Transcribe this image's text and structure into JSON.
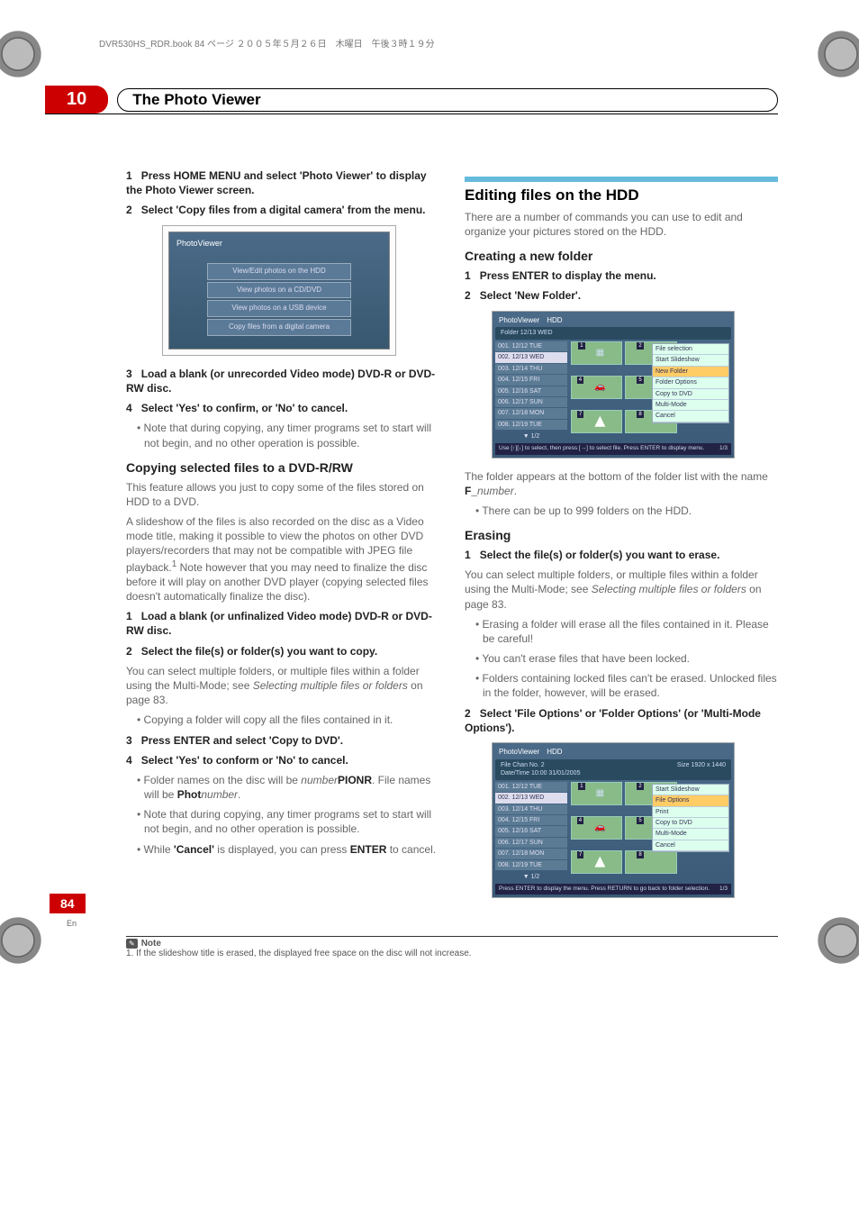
{
  "header_line": "DVR530HS_RDR.book  84 ページ  ２００５年５月２６日　木曜日　午後３時１９分",
  "chapter": {
    "num": "10",
    "title": "The Photo Viewer"
  },
  "left": {
    "s1": "Press HOME MENU and select 'Photo Viewer' to display the Photo Viewer screen.",
    "s2": "Select 'Copy files from a digital camera' from the menu.",
    "ss1_title": "PhotoViewer",
    "ss1_items": [
      "View/Edit photos on the HDD",
      "View photos on a CD/DVD",
      "View photos on a USB device",
      "Copy files from a digital camera"
    ],
    "s3": "Load a blank (or unrecorded Video mode) DVD-R or DVD-RW disc.",
    "s4": "Select 'Yes' to confirm, or 'No' to cancel.",
    "s4_bullet": "Note that during copying, any timer programs set to start will not begin, and no other operation is possible.",
    "h3a": "Copying selected files to a DVD-R/RW",
    "pa": "This feature allows you just to copy some of the files stored on HDD to a DVD.",
    "pb": "A slideshow of the files is also recorded on the disc as a Video mode title, making it possible to view the photos on other DVD players/recorders that may not be compatible with JPEG file playback.",
    "pb_sup": "1",
    "pb_tail": " Note however that you may need to finalize the disc before it will play on another DVD player (copying selected files doesn't automatically finalize the disc).",
    "s1b": "Load a blank (or unfinalized Video mode) DVD-R or DVD-RW disc.",
    "s2b": "Select the file(s) or folder(s) you want to copy.",
    "p2b": "You can select multiple folders, or multiple files within a folder using the Multi-Mode; see ",
    "p2b_it": "Selecting multiple files or folders",
    "p2b_tail": " on page 83.",
    "b2b": "Copying a folder will copy all the files contained in it.",
    "s3b": "Press ENTER and select 'Copy to DVD'.",
    "s4b": "Select 'Yes' to conform or 'No' to cancel.",
    "b4b1_pre": "Folder names on the disc will be ",
    "b4b1_it": "number",
    "b4b1_bold": "PIONR",
    "b4b1_post": ". File names will be ",
    "b4b1_bold2": "Phot",
    "b4b1_it2": "number",
    "b4b1_post2": ".",
    "b4b2": "Note that during copying, any timer programs set to start will not begin, and no other operation is possible.",
    "b4b3_pre": "While ",
    "b4b3_bold": "'Cancel'",
    "b4b3_mid": " is displayed, you can press ",
    "b4b3_bold2": "ENTER",
    "b4b3_post": " to cancel."
  },
  "right": {
    "h2": "Editing files on the HDD",
    "intro": "There are a number of commands you can use to edit and organize your pictures stored on the HDD.",
    "h3a": "Creating a new folder",
    "s1": "Press ENTER to display the menu.",
    "s2": "Select 'New Folder'.",
    "ss2": {
      "bar": [
        "PhotoViewer",
        "HDD"
      ],
      "sub": "Folder        12/13 WED",
      "rows": [
        "001. 12/12 TUE",
        "002. 12/13 WED",
        "003. 12/14 THU",
        "004. 12/15 FRI",
        "005. 12/16 SAT",
        "006. 12/17 SUN",
        "007. 12/18 MON",
        "008. 12/19 TUE"
      ],
      "menu": [
        "File selection",
        "Start Slideshow",
        "New Folder",
        "Folder Options",
        "Copy to DVD",
        "Multi-Mode",
        "Cancel"
      ],
      "menu_sel": "New Folder",
      "foot": "Use [↑][↓] to select, then press [→] to select file. Press ENTER to display menu.",
      "pager_l": "1/2",
      "pager_r": "1/3"
    },
    "after_ss2_pre": "The folder appears at the bottom of the folder list with the name ",
    "after_ss2_bold": "F_",
    "after_ss2_it": "number",
    "after_ss2_post": ".",
    "after_ss2_b": "There can be up to 999 folders on the HDD.",
    "h3b": "Erasing",
    "e1": "Select the file(s) or folder(s) you want to erase.",
    "e1p_pre": "You can select multiple folders, or multiple files within a folder using the Multi-Mode; see ",
    "e1p_it": "Selecting multiple files or folders",
    "e1p_post": " on page 83.",
    "eb1": "Erasing a folder will erase all the files contained in it. Please be careful!",
    "eb2": "You can't erase files that have been locked.",
    "eb3": "Folders containing locked files can't be erased. Unlocked files in the folder, however, will be erased.",
    "e2": "Select 'File Options' or 'Folder Options' (or 'Multi-Mode Options').",
    "ss3": {
      "bar": [
        "PhotoViewer",
        "HDD"
      ],
      "sub_l": "File             Chan No. 2",
      "sub_l2": "Date/Time     10:00 31/01/2005",
      "sub_r": "Size     1920 x 1440",
      "rows": [
        "001. 12/12 TUE",
        "002. 12/13 WED",
        "003. 12/14 THU",
        "004. 12/15 FRI",
        "005. 12/16 SAT",
        "006. 12/17 SUN",
        "007. 12/18 MON",
        "008. 12/19 TUE"
      ],
      "menu": [
        "Start Slideshow",
        "File Options",
        "Print",
        "Copy to DVD",
        "Multi-Mode",
        "Cancel"
      ],
      "menu_sel": "File Options",
      "foot": "Press ENTER to display the menu. Press RETURN to go back to folder selection.",
      "pager_l": "1/2",
      "pager_r": "1/3"
    }
  },
  "note": {
    "label": "Note",
    "text": "1. If the slideshow title is erased, the displayed free space on the disc will not increase."
  },
  "page_num": "84",
  "page_en": "En"
}
